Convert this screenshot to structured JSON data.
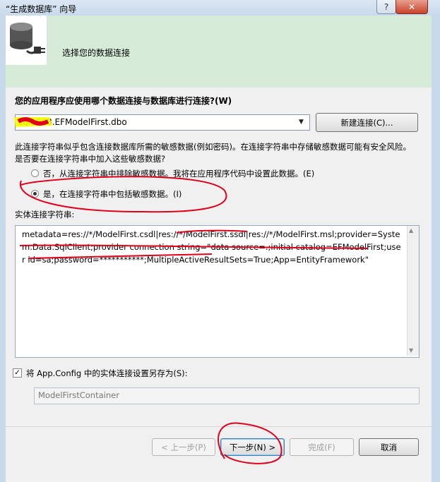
{
  "window": {
    "title": "“生成数据库” 向导",
    "help_label": "?",
    "close_label": "✕"
  },
  "header": {
    "title": "选择您的数据连接",
    "icon": "database-plug-icon"
  },
  "connection": {
    "question": "您的应用程序应使用哪个数据连接与数据库进行连接?(W)",
    "selected": "sql2008.EFModelFirst.dbo",
    "new_button": "新建连接(C)..."
  },
  "sensitive": {
    "warning": "此连接字符串似乎包含连接数据库所需的敏感数据(例如密码)。在连接字符串中存储敏感数据可能有安全风险。是否要在连接字符串中加入这些敏感数据?",
    "option_exclude": "否，从连接字符串中排除敏感数据。我将在应用程序代码中设置此数据。(E)",
    "option_include": "是，在连接字符串中包括敏感数据。(I)",
    "selected": "include"
  },
  "entity": {
    "label": "实体连接字符串:",
    "value": "metadata=res://*/ModelFirst.csdl|res://*/ModelFirst.ssdl|res://*/ModelFirst.msl;provider=System.Data.SqlClient;provider connection string=\"data source=.;initial catalog=EFModelFirst;user id=sa;password=***********;MultipleActiveResultSets=True;App=EntityFramework\""
  },
  "save": {
    "label": "将 App.Config 中的实体连接设置另存为(S):",
    "checked": true,
    "value": "ModelFirstContainer"
  },
  "buttons": {
    "prev": "< 上一步(P)",
    "next": "下一步(N) >",
    "finish": "完成(F)",
    "cancel": "取消"
  },
  "colors": {
    "header_bg": "#d6ecd9",
    "annotation_red": "#e0001b",
    "highlight_yellow": "#f5ff00"
  }
}
